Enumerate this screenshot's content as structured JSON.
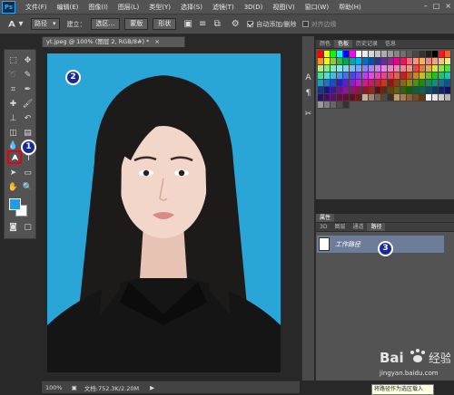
{
  "app": {
    "logo": "Ps"
  },
  "menu": [
    "文件(F)",
    "编辑(E)",
    "图像(I)",
    "图层(L)",
    "类型(Y)",
    "选择(S)",
    "滤镜(T)",
    "3D(D)",
    "视图(V)",
    "窗口(W)",
    "帮助(H)"
  ],
  "options_bar": {
    "tool_icon": "pen-icon",
    "mode": "路径",
    "build_label": "建立：",
    "selection_button": "选区...",
    "mask_button": "蒙版",
    "shape_button": "形状",
    "auto_add_delete": {
      "label": "自动添加/删除",
      "checked": true
    },
    "align_edges": {
      "label": "对齐边缘",
      "checked": false
    }
  },
  "document": {
    "tab_title": "yt.jpeg @ 100% (图层 2, RGB/8#) *",
    "zoom": "100%",
    "doc_info": "文档:752.3K/2.20M"
  },
  "toolbox": {
    "fg_color": "#1e9de5",
    "bg_color": "#ffffff",
    "highlighted_tool": "pen-tool"
  },
  "markers": [
    "1",
    "2",
    "3"
  ],
  "swatches_panel": {
    "tabs": [
      "颜色",
      "色板",
      "历史记录",
      "信息"
    ],
    "active_tab": "色板"
  },
  "paths_panel": {
    "title": "属性",
    "tabs": [
      "3D",
      "图层",
      "通道",
      "路径"
    ],
    "active_tab": "路径",
    "path_item": "工作路径",
    "tooltip": "将路径作为选区载入"
  },
  "watermark": {
    "brand": "Bai du 经验",
    "url": "jingyan.baidu.com"
  }
}
